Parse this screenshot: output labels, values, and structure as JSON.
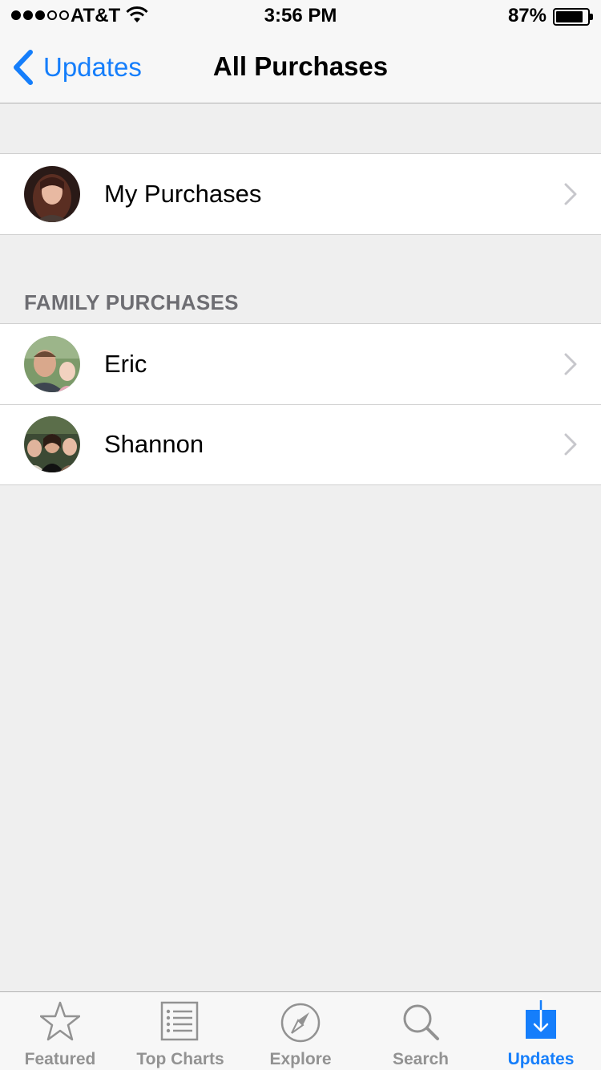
{
  "status_bar": {
    "carrier": "AT&T",
    "time": "3:56 PM",
    "battery_percent": "87%",
    "battery_level": 0.87,
    "signal_bars_filled": 3,
    "signal_bars_total": 5
  },
  "nav": {
    "back_label": "Updates",
    "title": "All Purchases"
  },
  "my_purchases": {
    "label": "My Purchases"
  },
  "family_section": {
    "header": "FAMILY PURCHASES",
    "members": [
      {
        "label": "Eric"
      },
      {
        "label": "Shannon"
      }
    ]
  },
  "tab_bar": {
    "tabs": [
      {
        "label": "Featured",
        "icon": "star-icon"
      },
      {
        "label": "Top Charts",
        "icon": "list-icon"
      },
      {
        "label": "Explore",
        "icon": "compass-icon"
      },
      {
        "label": "Search",
        "icon": "search-icon"
      },
      {
        "label": "Updates",
        "icon": "download-icon"
      }
    ],
    "active_tab": "Updates"
  },
  "colors": {
    "accent": "#157efb",
    "inactive": "#929292",
    "background": "#efefef"
  }
}
